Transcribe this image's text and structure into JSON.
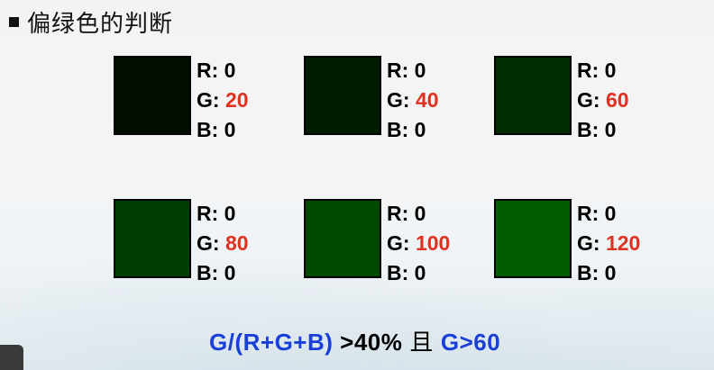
{
  "title": "偏绿色的判断",
  "labels": {
    "r": "R: ",
    "g": "G: ",
    "b": "B: "
  },
  "swatches": [
    {
      "r": "0",
      "g": "20",
      "b": "0",
      "color": "#000d00"
    },
    {
      "r": "0",
      "g": "40",
      "b": "0",
      "color": "#001c00"
    },
    {
      "r": "0",
      "g": "60",
      "b": "0",
      "color": "#002d00"
    },
    {
      "r": "0",
      "g": "80",
      "b": "0",
      "color": "#003e05"
    },
    {
      "r": "0",
      "g": "100",
      "b": "0",
      "color": "#004a00"
    },
    {
      "r": "0",
      "g": "120",
      "b": "0",
      "color": "#005e00"
    }
  ],
  "formula": {
    "part1": "G/(R+G+B)",
    "part2": " >40%",
    "conj": "且",
    "part3": "G>60"
  },
  "colors": {
    "accent_red": "#e03020",
    "formula_blue": "#1a3fd6"
  }
}
